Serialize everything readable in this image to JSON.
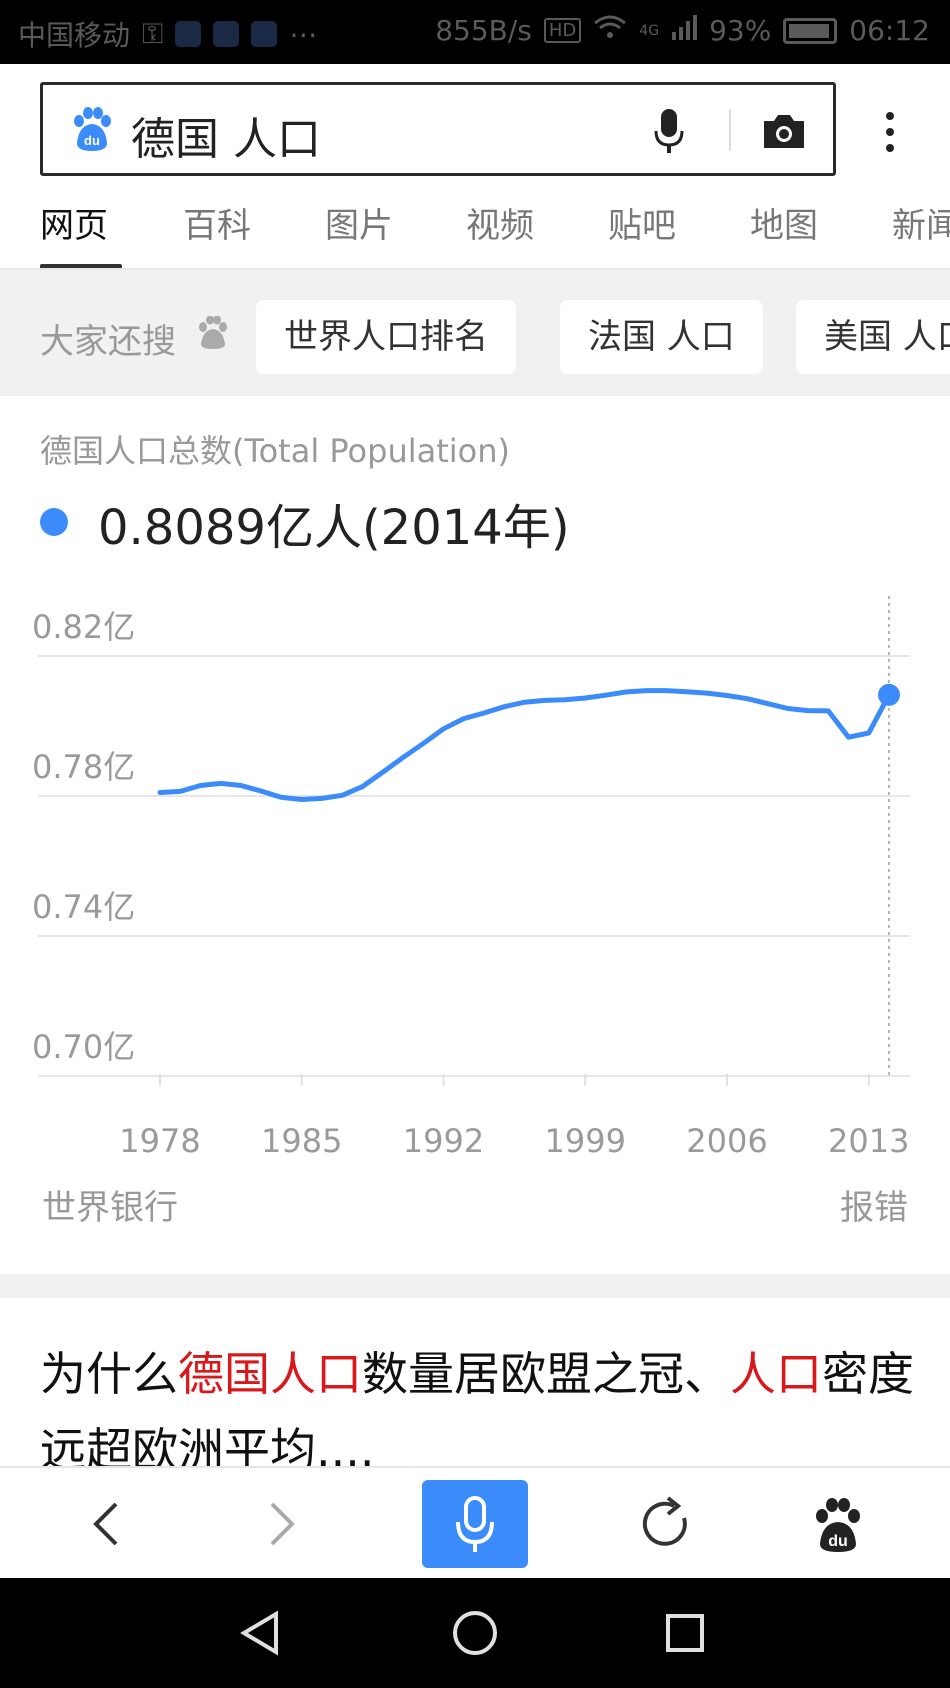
{
  "status_bar": {
    "carrier": "中国移动",
    "speed": "855B/s",
    "hd": "HD",
    "network": "4G",
    "battery": "93%",
    "time": "06:12"
  },
  "search": {
    "query": "德国 人口"
  },
  "tabs": [
    {
      "label": "网页",
      "active": true
    },
    {
      "label": "百科"
    },
    {
      "label": "图片"
    },
    {
      "label": "视频"
    },
    {
      "label": "贴吧"
    },
    {
      "label": "地图"
    },
    {
      "label": "新闻"
    }
  ],
  "related": {
    "label": "大家还搜",
    "chips": [
      "世界人口排名",
      "法国 人口",
      "美国 人口"
    ]
  },
  "card": {
    "title": "德国人口总数(Total Population)",
    "value": "0.8089亿人(2014年)",
    "source": "世界银行",
    "report": "报错"
  },
  "chart_data": {
    "type": "line",
    "y_ticks": [
      "0.82亿",
      "0.78亿",
      "0.74亿",
      "0.70亿"
    ],
    "x_ticks": [
      "1978",
      "1985",
      "1992",
      "1999",
      "2006",
      "2013"
    ],
    "ylim": [
      0.7,
      0.82
    ],
    "xlim": [
      1978,
      2014
    ],
    "grid": true,
    "series": [
      {
        "color": "#3b8bfa",
        "points": [
          [
            1978,
            0.781
          ],
          [
            1979,
            0.7813
          ],
          [
            1980,
            0.783
          ],
          [
            1981,
            0.7836
          ],
          [
            1982,
            0.783
          ],
          [
            1983,
            0.7814
          ],
          [
            1984,
            0.7796
          ],
          [
            1985,
            0.779
          ],
          [
            1986,
            0.7793
          ],
          [
            1987,
            0.7802
          ],
          [
            1988,
            0.7827
          ],
          [
            1989,
            0.7868
          ],
          [
            1990,
            0.791
          ],
          [
            1991,
            0.795
          ],
          [
            1992,
            0.7992
          ],
          [
            1993,
            0.8021
          ],
          [
            1994,
            0.8037
          ],
          [
            1995,
            0.8055
          ],
          [
            1996,
            0.8068
          ],
          [
            1997,
            0.8073
          ],
          [
            1998,
            0.8075
          ],
          [
            1999,
            0.808
          ],
          [
            2000,
            0.8088
          ],
          [
            2001,
            0.8097
          ],
          [
            2002,
            0.8101
          ],
          [
            2003,
            0.8101
          ],
          [
            2004,
            0.8098
          ],
          [
            2005,
            0.8094
          ],
          [
            2006,
            0.8087
          ],
          [
            2007,
            0.8078
          ],
          [
            2008,
            0.8064
          ],
          [
            2009,
            0.805
          ],
          [
            2010,
            0.8044
          ],
          [
            2011,
            0.8043
          ],
          [
            2012,
            0.7968
          ],
          [
            2013,
            0.798
          ],
          [
            2014,
            0.8089
          ]
        ]
      }
    ],
    "highlight": {
      "x": 2014,
      "y": 0.8089
    }
  },
  "article": {
    "parts": [
      {
        "text": "为什么",
        "hl": false
      },
      {
        "text": "德国人口",
        "hl": true
      },
      {
        "text": "数量居欧盟之冠、",
        "hl": false
      },
      {
        "text": "人口",
        "hl": true
      },
      {
        "text": "密度远超欧洲平均....",
        "hl": false
      }
    ]
  },
  "toolbar": {
    "icons": [
      "back-icon",
      "forward-icon",
      "microphone-icon",
      "refresh-icon",
      "baidu-icon"
    ]
  },
  "nav_bar": {
    "icons": [
      "back-triangle-icon",
      "home-circle-icon",
      "recents-square-icon"
    ]
  }
}
